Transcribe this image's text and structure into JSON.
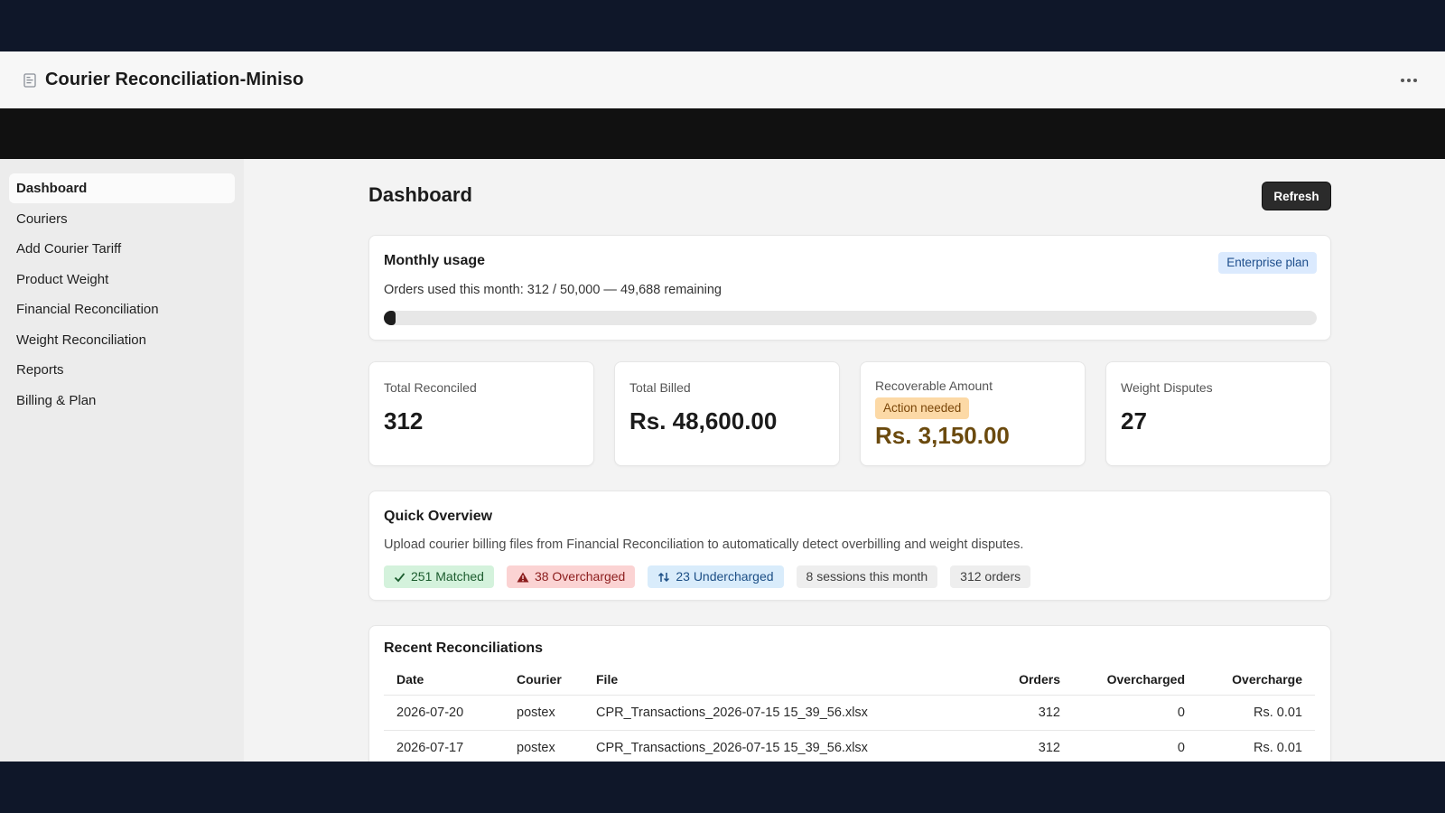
{
  "app": {
    "title": "Courier Reconciliation-Miniso",
    "icon": "document-icon"
  },
  "sidebar": {
    "items": [
      {
        "label": "Dashboard",
        "active": true
      },
      {
        "label": "Couriers"
      },
      {
        "label": "Add Courier Tariff"
      },
      {
        "label": "Product Weight"
      },
      {
        "label": "Financial Reconciliation"
      },
      {
        "label": "Weight Reconciliation"
      },
      {
        "label": "Reports"
      },
      {
        "label": "Billing & Plan"
      }
    ]
  },
  "main": {
    "title": "Dashboard",
    "refresh_label": "Refresh"
  },
  "usage": {
    "heading": "Monthly usage",
    "plan_badge": "Enterprise plan",
    "summary": "Orders used this month: 312 / 50,000 — 49,688 remaining",
    "used": 312,
    "limit": 50000,
    "progress_fraction": 0.00624
  },
  "stats": [
    {
      "label": "Total Reconciled",
      "value": "312"
    },
    {
      "label": "Total Billed",
      "value": "Rs. 48,600.00"
    },
    {
      "label": "Recoverable Amount",
      "badge": "Action needed",
      "value": "Rs. 3,150.00"
    },
    {
      "label": "Weight Disputes",
      "value": "27"
    }
  ],
  "overview": {
    "heading": "Quick Overview",
    "description": "Upload courier billing files from Financial Reconciliation to automatically detect overbilling and weight disputes.",
    "chips": {
      "matched": "251 Matched",
      "overcharged": "38 Overcharged",
      "undercharged": "23 Undercharged",
      "sessions": "8 sessions this month",
      "orders": "312 orders"
    }
  },
  "recent": {
    "heading": "Recent Reconciliations",
    "columns": [
      "Date",
      "Courier",
      "File",
      "Orders",
      "Overcharged",
      "Overcharge"
    ],
    "rows": [
      [
        "2026-07-20",
        "postex",
        "CPR_Transactions_2026-07-15 15_39_56.xlsx",
        "312",
        "0",
        "Rs. 0.01"
      ],
      [
        "2026-07-17",
        "postex",
        "CPR_Transactions_2026-07-15 15_39_56.xlsx",
        "312",
        "0",
        "Rs. 0.01"
      ]
    ]
  },
  "colors": {
    "accent_dark": "#1e1e1e",
    "plan_badge_bg": "#dbeafe",
    "action_badge_bg": "#fcd9a6",
    "matched_bg": "#d4f2dc",
    "overcharged_bg": "#fbd3d3",
    "undercharged_bg": "#d9ecfb"
  }
}
